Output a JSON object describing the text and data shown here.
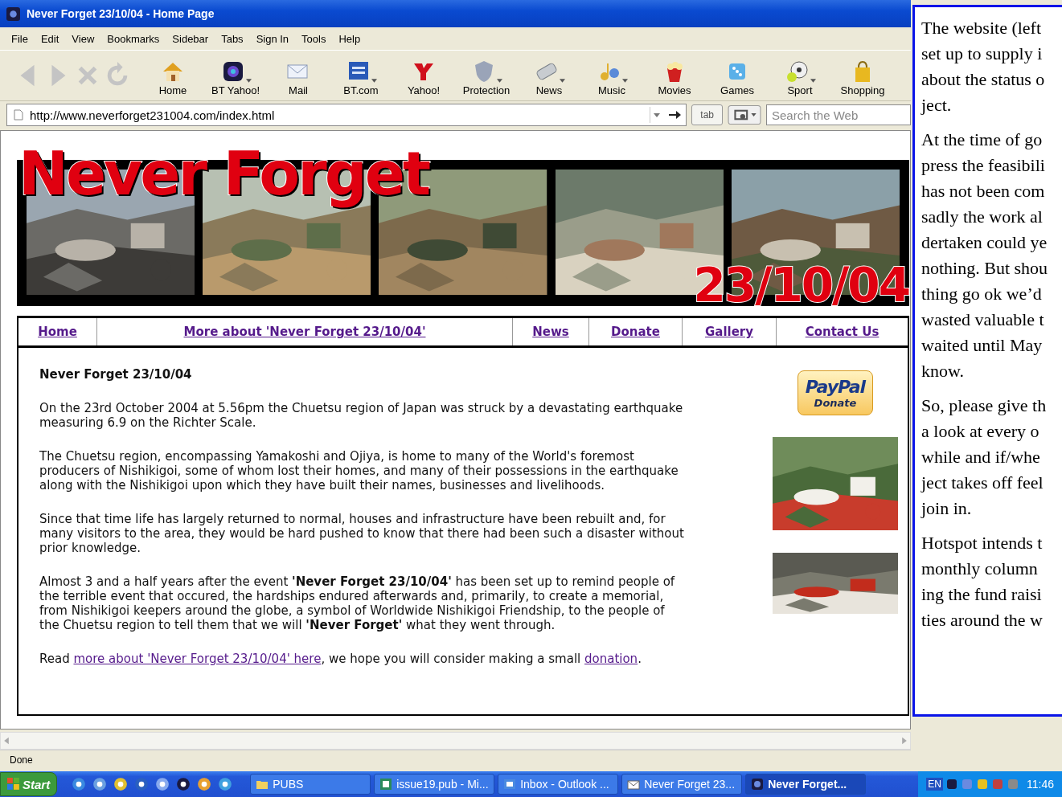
{
  "window": {
    "title": "Never Forget 23/10/04 - Home Page"
  },
  "menu": [
    "File",
    "Edit",
    "View",
    "Bookmarks",
    "Sidebar",
    "Tabs",
    "Sign In",
    "Tools",
    "Help"
  ],
  "nav_buttons": [
    {
      "kind": "back",
      "disabled": true
    },
    {
      "kind": "forward",
      "disabled": true
    },
    {
      "kind": "stop",
      "disabled": true
    },
    {
      "kind": "reload",
      "disabled": true
    }
  ],
  "toolbar": [
    {
      "label": "Home",
      "kind": "home",
      "has_menu": false
    },
    {
      "label": "BT Yahoo!",
      "kind": "bt-yahoo",
      "has_menu": true
    },
    {
      "label": "Mail",
      "kind": "mail",
      "has_menu": false
    },
    {
      "label": "BT.com",
      "kind": "bt",
      "has_menu": true
    },
    {
      "label": "Yahoo!",
      "kind": "yahoo",
      "has_menu": false
    },
    {
      "label": "Protection",
      "kind": "shield",
      "has_menu": true
    },
    {
      "label": "News",
      "kind": "news",
      "has_menu": true
    },
    {
      "label": "Music",
      "kind": "music",
      "has_menu": true
    },
    {
      "label": "Movies",
      "kind": "movies",
      "has_menu": false
    },
    {
      "label": "Games",
      "kind": "games",
      "has_menu": false
    },
    {
      "label": "Sport",
      "kind": "sport",
      "has_menu": true
    },
    {
      "label": "Shopping",
      "kind": "shopping",
      "has_menu": false
    }
  ],
  "address_bar": {
    "url": "http://www.neverforget231004.com/index.html",
    "tab_button": "tab",
    "search_placeholder": "Search the Web"
  },
  "banner": {
    "title": "Never Forget",
    "date": "23/10/04"
  },
  "site_nav": [
    "Home",
    "More about 'Never Forget 23/10/04'",
    "News",
    "Donate",
    "Gallery",
    "Contact Us"
  ],
  "content": {
    "heading": "Never Forget 23/10/04",
    "paragraphs": [
      "On the 23rd October 2004 at 5.56pm the Chuetsu region of Japan was struck by a devastating earthquake measuring 6.9 on the Richter Scale.",
      "The Chuetsu region, encompassing Yamakoshi and Ojiya, is home to many of the World's foremost producers of Nishikigoi, some of whom lost their homes, and many of their possessions in the earthquake along with the Nishikigoi upon which they have built their names, businesses and livelihoods.",
      "Since that time life has largely returned to normal, houses and infrastructure have been rebuilt and, for many visitors to the area, they would be hard pushed to know that there had been such a disaster without prior knowledge.",
      "Almost 3 and a half years after the event **'Never Forget 23/10/04'** has been set up to remind people of the terrible event that occured, the hardships endured afterwards and, primarily, to create a memorial, from Nishikigoi keepers around the globe, a symbol of Worldwide Nishikigoi Friendship, to the people of the Chuetsu region to tell them that we will **'Never Forget'** what they went through."
    ],
    "closing": [
      {
        "text": "Read ",
        "kind": "text"
      },
      {
        "text": "more about 'Never Forget 23/10/04' here",
        "kind": "link"
      },
      {
        "text": ", we hope you will consider making a small ",
        "kind": "text"
      },
      {
        "text": "donation",
        "kind": "link"
      },
      {
        "text": ".",
        "kind": "text"
      }
    ]
  },
  "paypal": {
    "brand": "PayPal",
    "label": "Donate"
  },
  "status_bar": "Done",
  "taskbar": {
    "start": "Start",
    "tasks": [
      {
        "label": "PUBS",
        "kind": "folder",
        "selected": false
      },
      {
        "label": "issue19.pub - Mi...",
        "kind": "publisher",
        "selected": false
      },
      {
        "label": "Inbox - Outlook ...",
        "kind": "outlook",
        "selected": false
      },
      {
        "label": "Never Forget 23...",
        "kind": "page",
        "selected": false
      },
      {
        "label": "Never Forget...",
        "kind": "browser",
        "selected": true
      }
    ],
    "language": "EN",
    "clock": "11:46"
  },
  "article": [
    [
      "The website (left",
      "set up to supply i",
      "about the status o",
      "ject."
    ],
    [
      "At the time of go",
      "press the feasibili",
      "has not been com",
      "sadly the work al",
      "dertaken could ye",
      "nothing. But shou",
      "thing go ok we’d",
      "wasted valuable t",
      "waited until May",
      "know."
    ],
    [
      "So, please give th",
      "a look at every o",
      "while and if/whe",
      "ject takes off feel",
      "join in."
    ],
    [
      "Hotspot intends t",
      "monthly column",
      "ing the fund raisi",
      "ties around the w"
    ]
  ]
}
